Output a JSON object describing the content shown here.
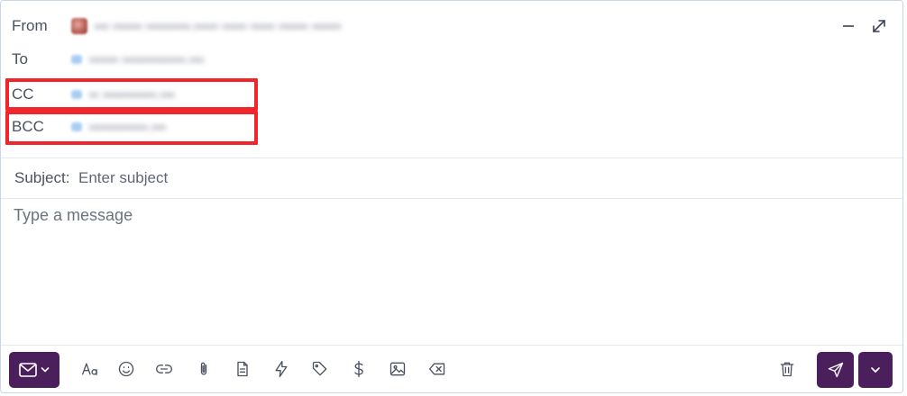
{
  "header": {
    "from_label": "From",
    "from_value": "••• •••••• •••••••••.•••••      ••••• •••••      •••••• ••••••",
    "to_label": "To",
    "to_value": "•••••• •••••••••••••.•••",
    "cc_label": "CC",
    "cc_value": "•• •••••••••••.•••",
    "bcc_label": "BCC",
    "bcc_value": "••••••••••••.•••"
  },
  "subject": {
    "label": "Subject:",
    "placeholder": "Enter subject",
    "value": ""
  },
  "message": {
    "placeholder": "Type a message",
    "value": ""
  },
  "toolbar": {
    "tools": [
      "font-format-icon",
      "emoji-icon",
      "link-icon",
      "attachment-icon",
      "template-icon",
      "lightning-icon",
      "tag-icon",
      "dollar-icon",
      "image-icon",
      "clear-format-icon"
    ]
  },
  "colors": {
    "accent": "#4a1f5c",
    "highlight": "#f0262c",
    "border": "#c9d6e8"
  }
}
